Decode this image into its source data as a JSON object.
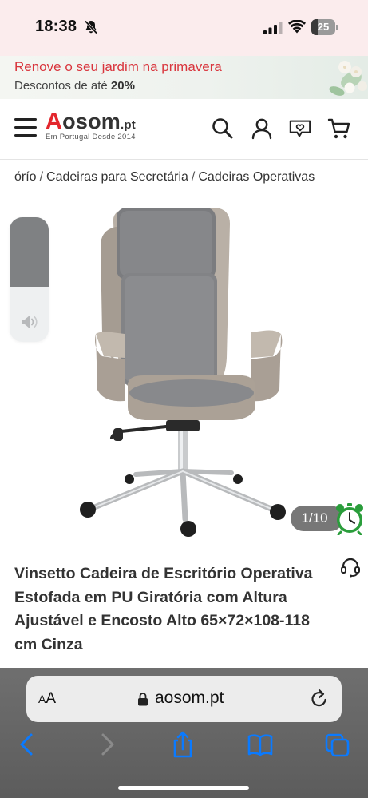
{
  "status_bar": {
    "time": "18:38",
    "battery_level": "25"
  },
  "promo": {
    "title": "Renove o seu jardim na primavera",
    "subtitle_prefix": "Descontos de até ",
    "subtitle_highlight": "20%"
  },
  "header": {
    "logo_letter": "A",
    "logo_name": "osom",
    "logo_tld": ".pt",
    "logo_tagline": "Em Portugal Desde 2014",
    "icons": [
      "menu-icon",
      "search-icon",
      "account-icon",
      "wishlist-icon",
      "cart-icon"
    ]
  },
  "breadcrumb": {
    "items": [
      "órío",
      "Cadeiras para Secretária",
      "Cadeiras Operativas"
    ]
  },
  "gallery": {
    "counter": "1/10"
  },
  "product": {
    "title": "Vinsetto Cadeira de Escritório Operativa Estofada em PU Giratória com Altura Ajustável e Encosto Alto 65×72×108-118 cm Cinza"
  },
  "browser": {
    "aa_small": "A",
    "aa_large": "A",
    "url": "aosom.pt"
  },
  "colors": {
    "brand_red": "#e3262d",
    "promo_red": "#d9363e",
    "safari_blue": "#0a7aff",
    "counter_bg": "#777777"
  },
  "volume": {
    "level": 0.56
  }
}
